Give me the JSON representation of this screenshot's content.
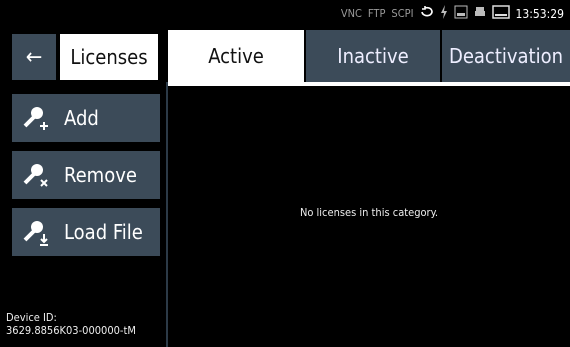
{
  "status": {
    "items": [
      "VNC",
      "FTP",
      "SCPI"
    ],
    "time": "13:53:29"
  },
  "header": {
    "back_label": "←",
    "title": "Licenses",
    "tabs": [
      {
        "label": "Active"
      },
      {
        "label": "Inactive"
      },
      {
        "label": "Deactivation"
      }
    ]
  },
  "sidebar": {
    "buttons": [
      {
        "label": "Add",
        "icon": "key-add-icon"
      },
      {
        "label": "Remove",
        "icon": "key-remove-icon"
      },
      {
        "label": "Load File",
        "icon": "key-load-icon"
      }
    ],
    "device_label": "Device ID:",
    "device_id": "3629.8856K03-000000-tM"
  },
  "main": {
    "message": "No licenses in this category."
  },
  "colors": {
    "button_bg": "#3c4b59",
    "active_bg": "#ffffff",
    "background": "#000000"
  }
}
